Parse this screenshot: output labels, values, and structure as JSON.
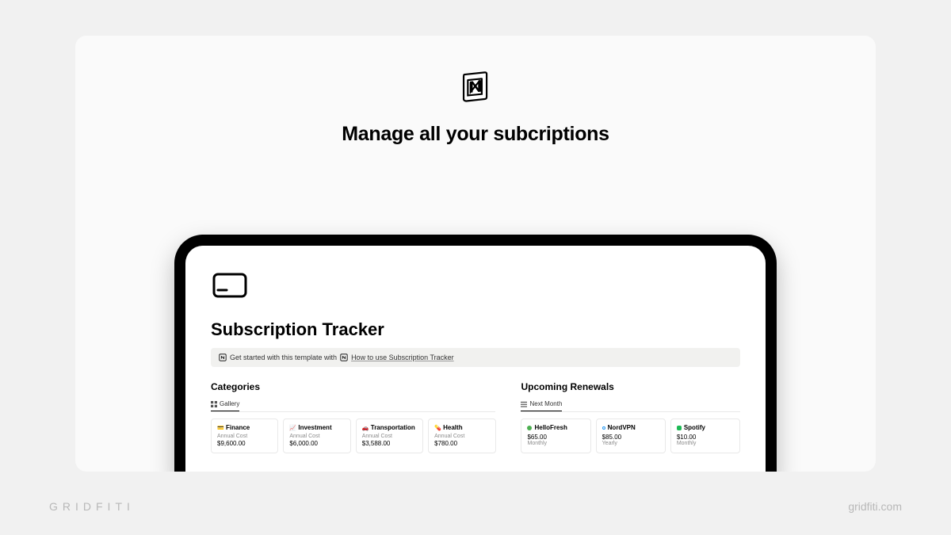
{
  "headline": "Manage all your subcriptions",
  "page_title": "Subscription Tracker",
  "callout": {
    "prefix": "Get started with this template with",
    "link": "How to use Subscription Tracker"
  },
  "sections": {
    "categories": {
      "title": "Categories",
      "tab": "Gallery",
      "items": [
        {
          "emoji": "💳",
          "name": "Finance",
          "label": "Annual Cost",
          "value": "$9,600.00"
        },
        {
          "emoji": "📈",
          "name": "Investment",
          "label": "Annual Cost",
          "value": "$6,000.00"
        },
        {
          "emoji": "🚗",
          "name": "Transportation",
          "label": "Annual Cost",
          "value": "$3,588.00"
        },
        {
          "emoji": "💊",
          "name": "Health",
          "label": "Annual Cost",
          "value": "$780.00"
        }
      ]
    },
    "renewals": {
      "title": "Upcoming Renewals",
      "tab": "Next Month",
      "items": [
        {
          "icon": "green",
          "name": "HelloFresh",
          "value": "$65.00",
          "label": "Monthly"
        },
        {
          "icon": "blue-ring",
          "name": "NordVPN",
          "value": "$85.00",
          "label": "Yearly"
        },
        {
          "icon": "spotify",
          "name": "Spotify",
          "value": "$10.00",
          "label": "Monthly"
        }
      ]
    }
  },
  "footer": {
    "left": "GRIDFITI",
    "right": "gridfiti.com"
  }
}
